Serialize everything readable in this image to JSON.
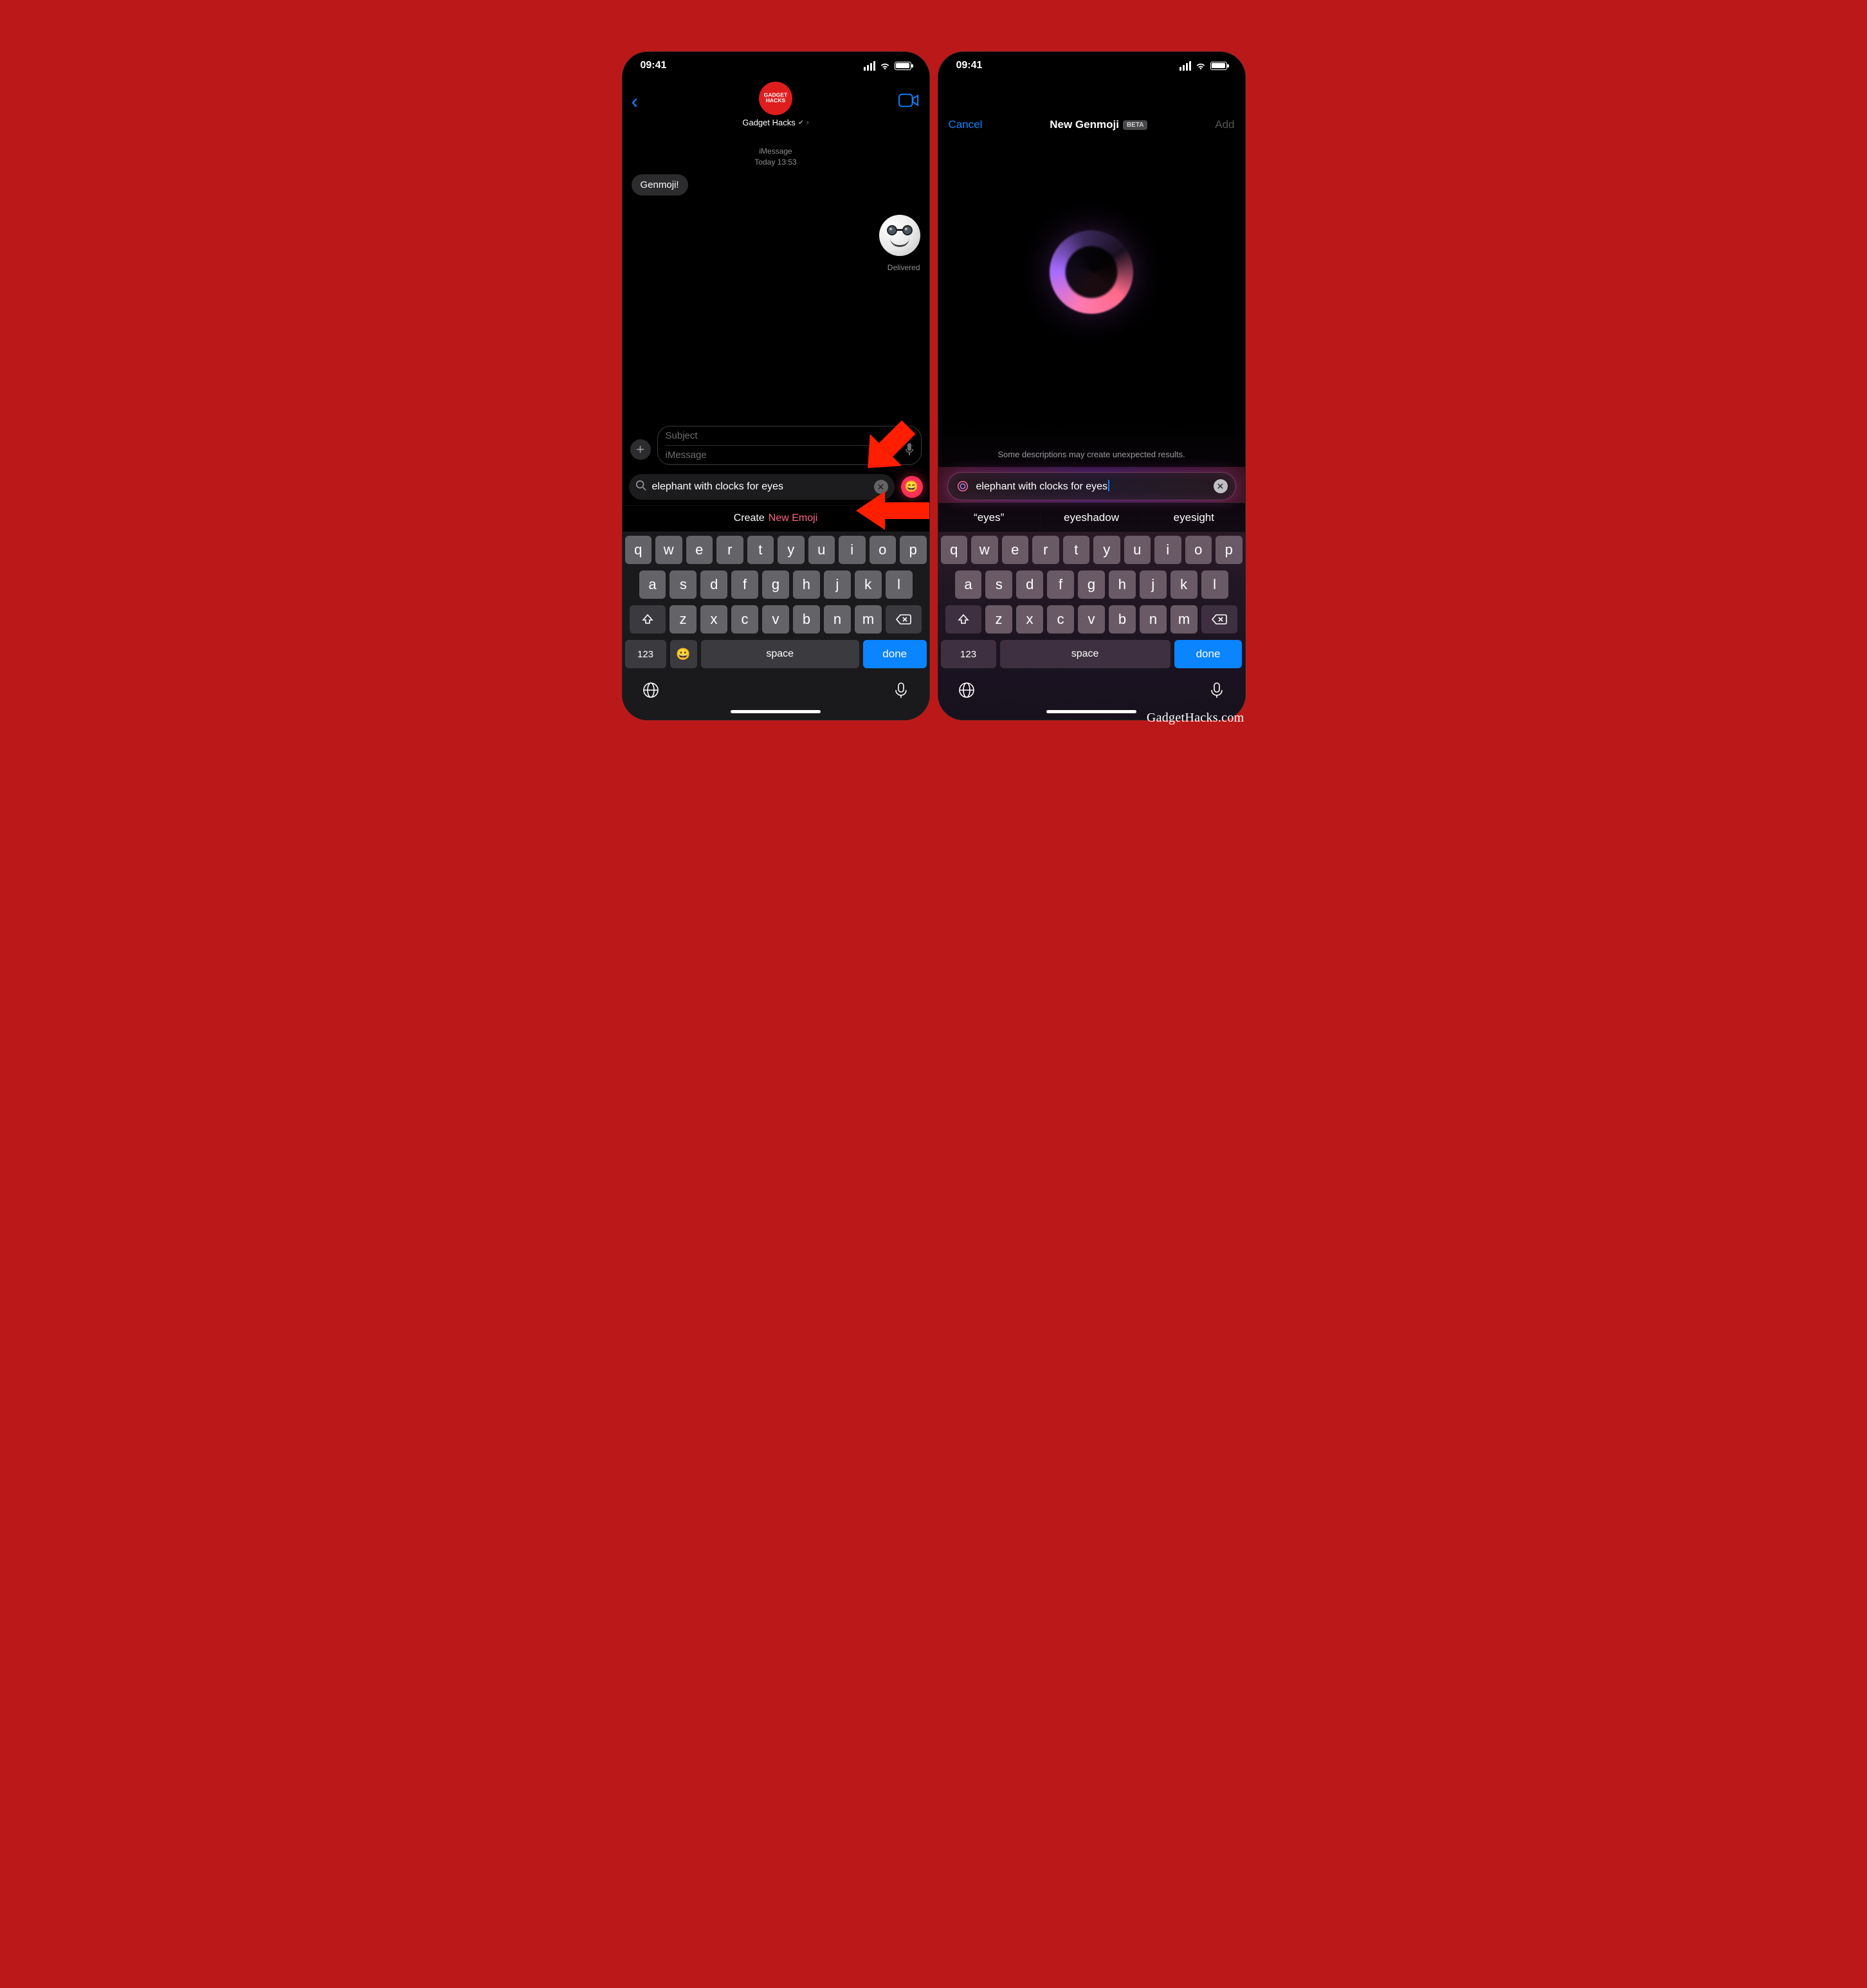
{
  "watermark": "GadgetHacks.com",
  "statusbar": {
    "time": "09:41"
  },
  "left": {
    "contact_name": "Gadget Hacks",
    "avatar_text": "GADGET HACKS",
    "thread_meta_line1": "iMessage",
    "thread_meta_line2": "Today 13:53",
    "incoming_msg": "Genmoji!",
    "delivered": "Delivered",
    "subject_placeholder": "Subject",
    "imessage_placeholder": "iMessage",
    "search_value": "elephant with clocks for eyes",
    "create_label": "Create ",
    "create_new": "New Emoji"
  },
  "right": {
    "cancel": "Cancel",
    "title": "New Genmoji",
    "beta": "BETA",
    "add": "Add",
    "warning": "Some descriptions may create unexpected results.",
    "search_value": "elephant with clocks for eyes",
    "suggestions": [
      "“eyes”",
      "eyeshadow",
      "eyesight"
    ]
  },
  "keyboard": {
    "row1": [
      "q",
      "w",
      "e",
      "r",
      "t",
      "y",
      "u",
      "i",
      "o",
      "p"
    ],
    "row2": [
      "a",
      "s",
      "d",
      "f",
      "g",
      "h",
      "j",
      "k",
      "l"
    ],
    "row3": [
      "z",
      "x",
      "c",
      "v",
      "b",
      "n",
      "m"
    ],
    "numbers": "123",
    "space": "space",
    "done": "done"
  }
}
